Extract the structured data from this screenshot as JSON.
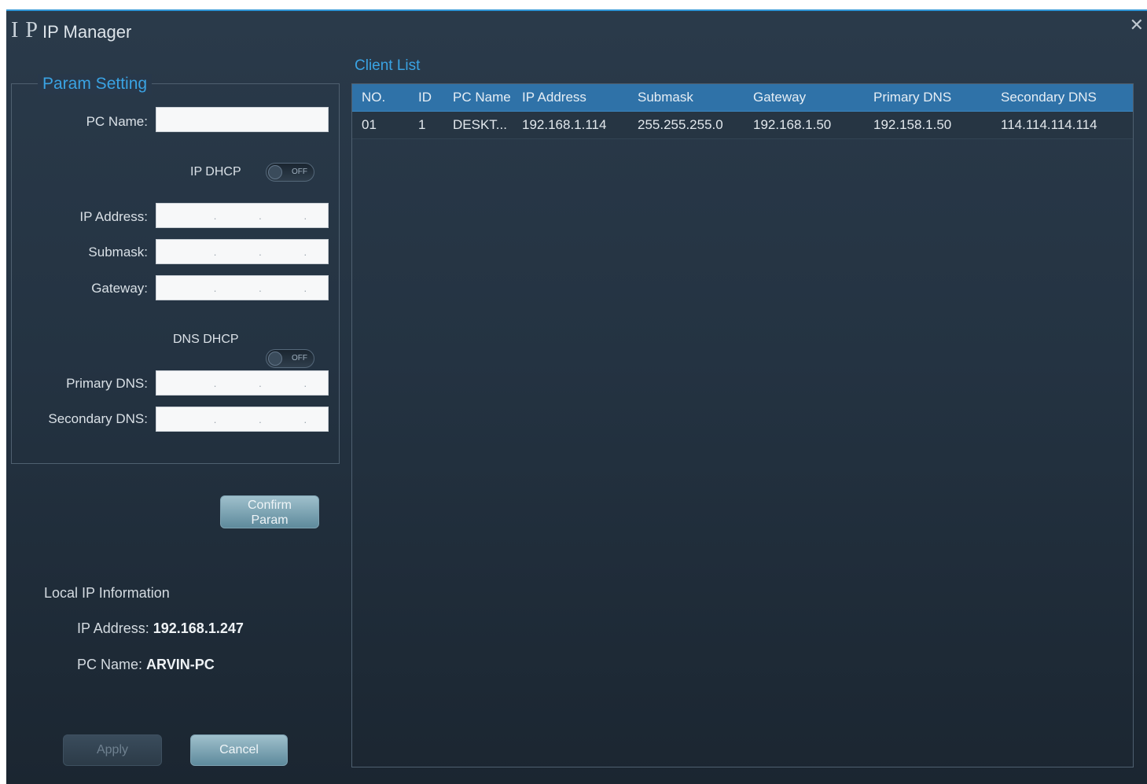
{
  "window": {
    "logo": "I P",
    "title": "IP Manager",
    "close_glyph": "✕"
  },
  "param_setting": {
    "legend": "Param Setting",
    "pc_name_label": "PC Name:",
    "pc_name_value": "",
    "ip_dhcp_label": "IP DHCP",
    "ip_dhcp_state": "OFF",
    "ip_address_label": "IP Address:",
    "submask_label": "Submask:",
    "gateway_label": "Gateway:",
    "dns_dhcp_label": "DNS DHCP",
    "dns_dhcp_state": "OFF",
    "primary_dns_label": "Primary DNS:",
    "secondary_dns_label": "Secondary DNS:",
    "ip_dot": "."
  },
  "confirm_button": {
    "line1": "Confirm",
    "line2": "Param"
  },
  "local_info": {
    "heading": "Local IP Information",
    "ip_label": "IP Address:",
    "ip_value": "192.168.1.247",
    "pc_label": "PC Name:",
    "pc_value": "ARVIN-PC"
  },
  "footer": {
    "apply_label": "Apply",
    "cancel_label": "Cancel"
  },
  "client_list": {
    "title": "Client List",
    "columns": [
      "NO.",
      "ID",
      "PC Name",
      "IP Address",
      "Submask",
      "Gateway",
      "Primary DNS",
      "Secondary DNS"
    ],
    "rows": [
      [
        "01",
        "1",
        "DESKT...",
        "192.168.1.114",
        "255.255.255.0",
        "192.168.1.50",
        "192.158.1.50",
        "114.114.114.114"
      ]
    ]
  }
}
